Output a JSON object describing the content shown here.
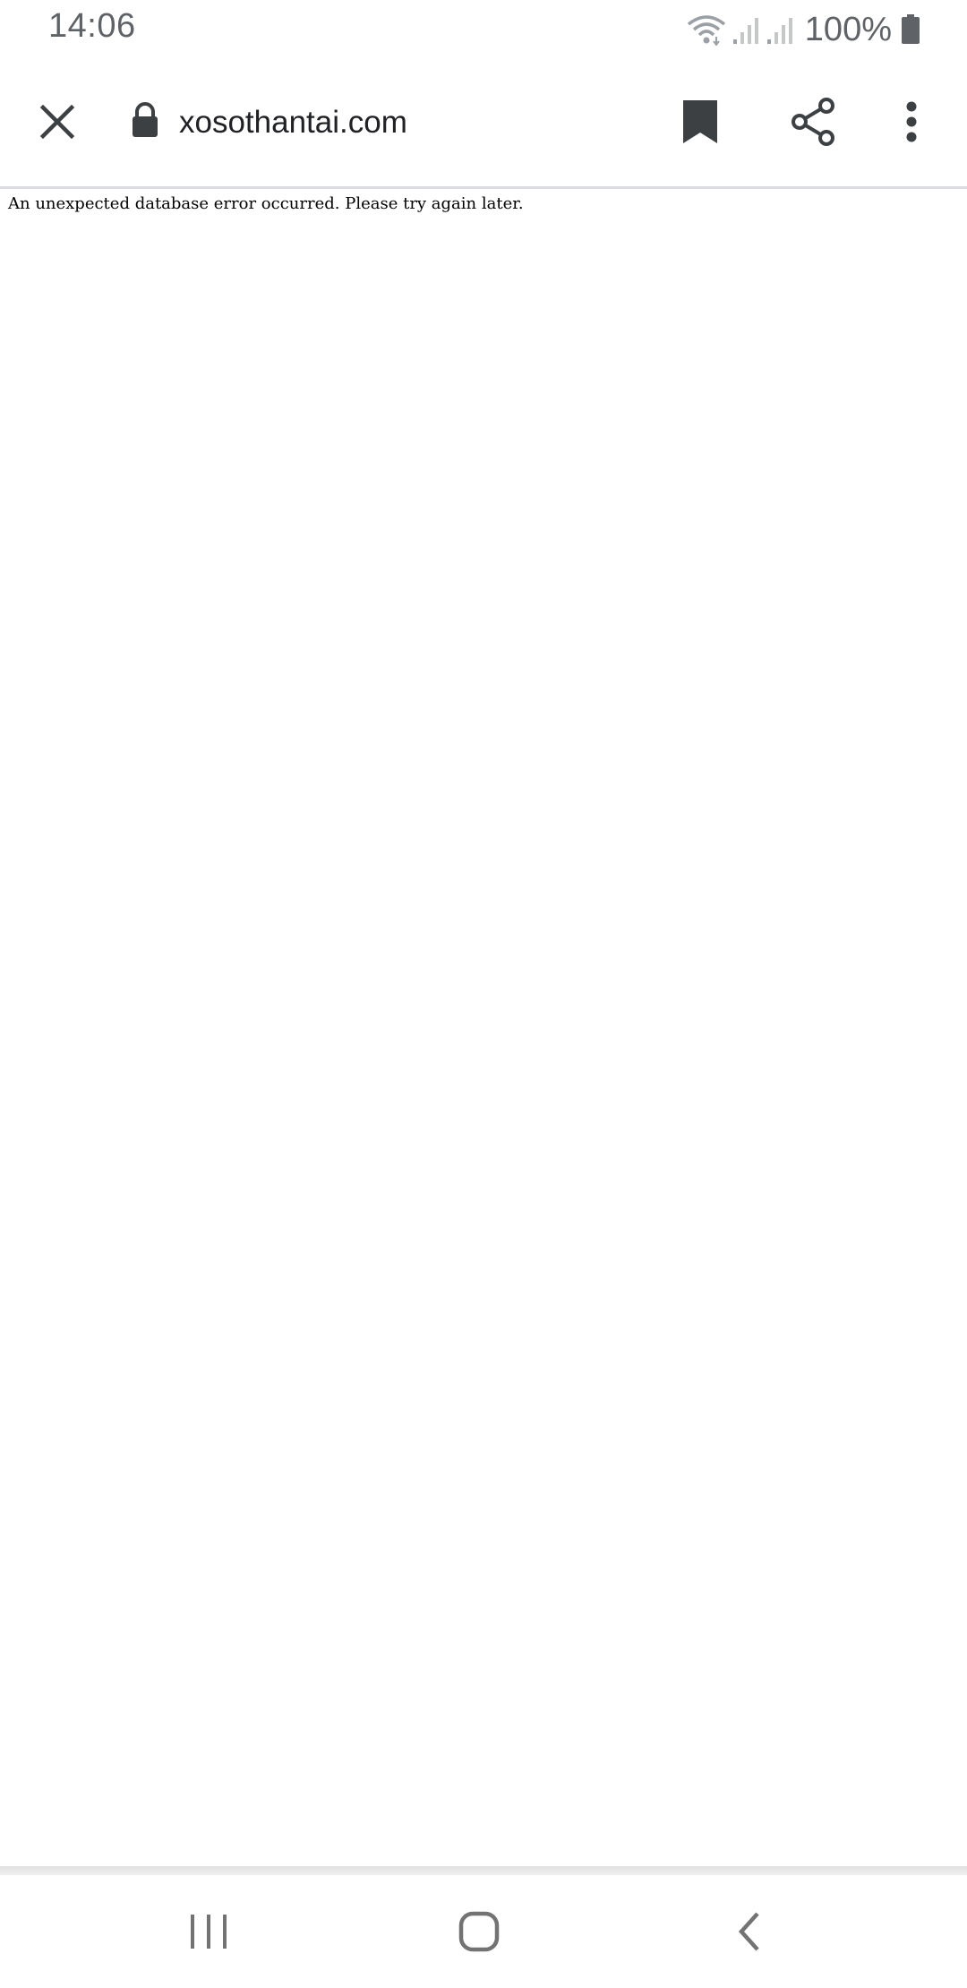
{
  "status_bar": {
    "time": "14:06",
    "battery_percent": "100%",
    "icons": [
      "wifi-icon",
      "signal-icon",
      "signal-icon",
      "battery-icon"
    ]
  },
  "toolbar": {
    "url": "xosothantai.com",
    "icons": [
      "close-icon",
      "lock-icon",
      "bookmark-icon",
      "share-icon",
      "more-vert-icon"
    ]
  },
  "page": {
    "error_message": "An unexpected database error occurred. Please try again later."
  },
  "nav_bar": {
    "icons": [
      "recents-icon",
      "home-icon",
      "back-icon"
    ]
  },
  "colors": {
    "icon": "#3c4043",
    "status_text": "#5f6368",
    "divider": "#dadce0"
  }
}
